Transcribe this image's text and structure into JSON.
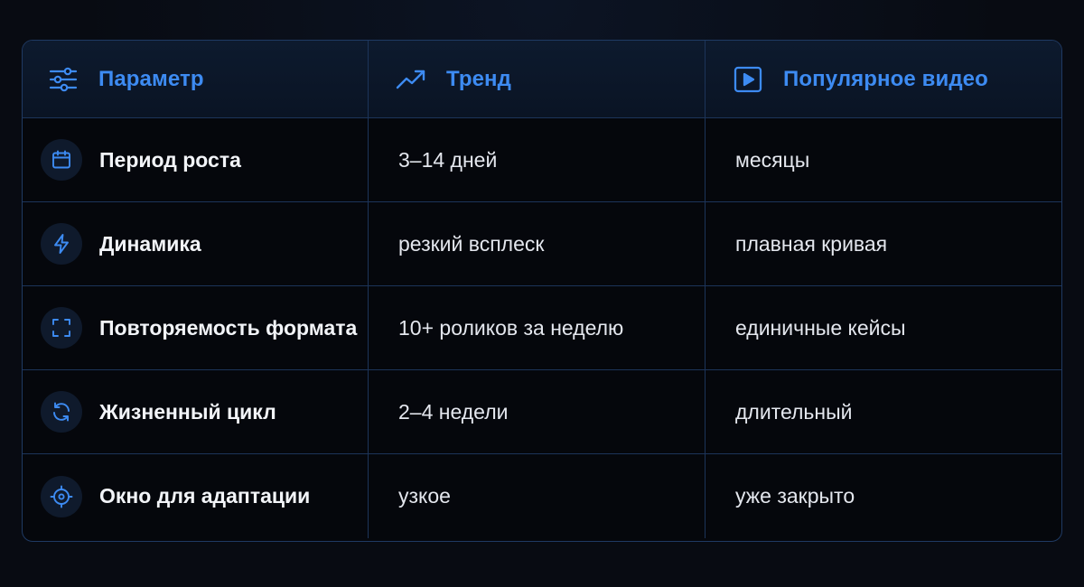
{
  "colors": {
    "accent": "#3d8bf2",
    "background": "#080b12",
    "border": "#1c3459",
    "text": "#e4e7ee"
  },
  "header": {
    "param_label": "Параметр",
    "param_icon": "sliders-icon",
    "trend_label": "Тренд",
    "trend_icon": "trending-up-icon",
    "popular_label": "Популярное видео",
    "popular_icon": "play-square-icon"
  },
  "rows": [
    {
      "icon": "calendar-icon",
      "param": "Период роста",
      "trend": "3–14 дней",
      "popular": "месяцы"
    },
    {
      "icon": "lightning-icon",
      "param": "Динамика",
      "trend": "резкий всплеск",
      "popular": "плавная кривая"
    },
    {
      "icon": "frame-corners-icon",
      "param": "Повторяемость формата",
      "trend": "10+ роликов за неделю",
      "popular": "единичные кейсы"
    },
    {
      "icon": "refresh-icon",
      "param": "Жизненный цикл",
      "trend": "2–4 недели",
      "popular": "длительный"
    },
    {
      "icon": "crosshair-icon",
      "param": "Окно для адаптации",
      "trend": "узкое",
      "popular": "уже закрыто"
    }
  ]
}
